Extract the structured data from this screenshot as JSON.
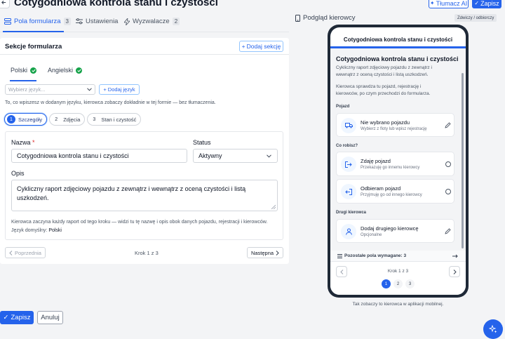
{
  "header": {
    "title": "Cotygodniowa kontrola stanu i czystości",
    "translate_label": "Tłumacz AI",
    "save_label": "Zapisz"
  },
  "tabs": [
    {
      "label": "Pola formularza",
      "count": "3",
      "active": true
    },
    {
      "label": "Ustawienia"
    },
    {
      "label": "Wyzwalacze",
      "count": "2"
    }
  ],
  "sections": {
    "title": "Sekcje formularza",
    "add_label": "Dodaj sekcję"
  },
  "languages": {
    "items": [
      {
        "label": "Polski",
        "complete": true,
        "active": true
      },
      {
        "label": "Angielski",
        "complete": true
      }
    ],
    "select_placeholder": "Wybierz język...",
    "add_label": "Dodaj język",
    "hint": "To, co wpiszesz w dodanym języku, kierowca zobaczy dokładnie w tej formie — bez tłumaczenia."
  },
  "steps": [
    {
      "num": "1",
      "label": "Szczegóły",
      "active": true
    },
    {
      "num": "2",
      "label": "Zdjęcia"
    },
    {
      "num": "3",
      "label": "Stan i czystość"
    }
  ],
  "details": {
    "name_label": "Nazwa",
    "name_required": "*",
    "name_value": "Cotygodniowa kontrola stanu i czystości",
    "status_label": "Status",
    "status_value": "Aktywny",
    "desc_label": "Opis",
    "desc_value": "Cykliczny raport zdjęciowy pojazdu z zewnątrz i wewnątrz z oceną czystości i listą uszkodzeń.",
    "help_line1": "Kierowca zaczyna każdy raport od tego kroku — widzi tu tę nazwę i opis obok danych pojazdu, rejestracji i kierowców.",
    "default_lang_label": "Język domyślny:",
    "default_lang_value": "Polski"
  },
  "pager": {
    "prev_label": "Poprzednia",
    "next_label": "Następna",
    "step_text": "Krok 1 z 3"
  },
  "footer": {
    "save_label": "Zapisz",
    "cancel_label": "Anuluj"
  },
  "preview": {
    "title": "Podgląd kierowcy",
    "collapse_label": "Zdwiczy / odbiorczy",
    "phone_title": "Cotygodniowa kontrola stanu i czystości",
    "heading": "Cotygodniowa kontrola stanu i czystości",
    "desc_line1": "Cykliczny raport zdjęciowy pojazdu z zewnątrz i",
    "desc_line2": "wewnątrz z oceną czystości i listą uszkodzeń.",
    "intro_line1": "Kierowca sprawdza tu pojazd, rejestrację i",
    "intro_line2": "kierowców, po czym przechodzi do formularza.",
    "vehicle_section": "Pojazd",
    "vehicle_title": "Nie wybrano pojazdu",
    "vehicle_sub": "Wybierz z floty lub wpisz rejestrację",
    "action_section": "Co robisz?",
    "handover_title": "Zdaję pojazd",
    "handover_sub": "Przekazuję go innemu kierowcy",
    "pickup_title": "Odbieram pojazd",
    "pickup_sub": "Przyjmuję go od innego kierowcy",
    "driver_section": "Drugi kierowca",
    "driver_title": "Dodaj drugiego kierowcę",
    "driver_sub": "Opcjonalne",
    "remaining": "Pozostałe pola wymagane: 3",
    "step_text": "Krok 1 z 3",
    "dots": [
      "1",
      "2",
      "3"
    ],
    "caption": "Tak zobaczy to kierowca w aplikacji mobilnej."
  },
  "colors": {
    "accent": "#2563eb",
    "success": "#16a34a",
    "phone_frame": "#1f2937"
  }
}
